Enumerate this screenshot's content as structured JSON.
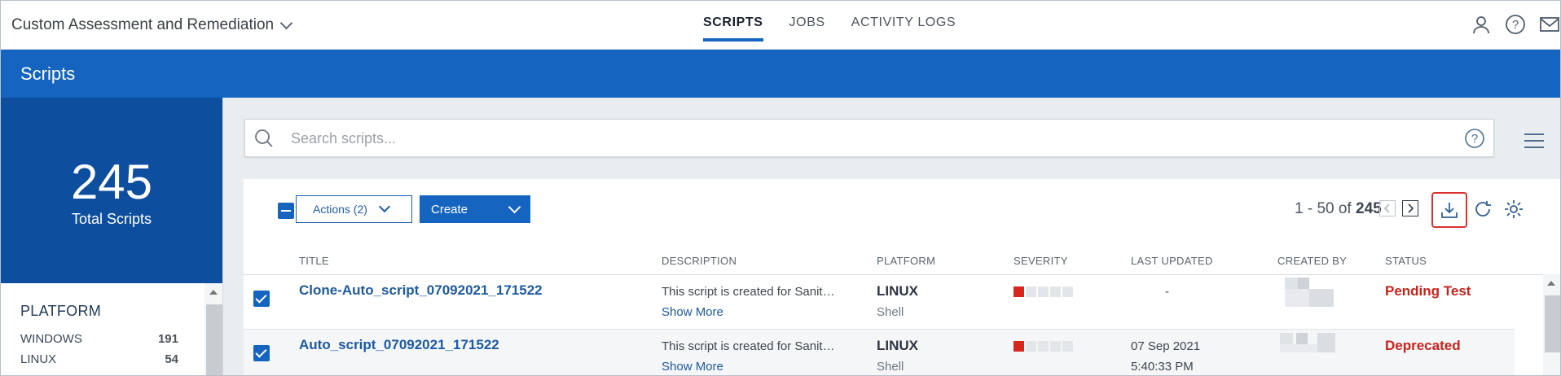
{
  "app": {
    "title": "Custom Assessment and Remediation"
  },
  "nav": {
    "tabs": [
      "SCRIPTS",
      "JOBS",
      "ACTIVITY LOGS"
    ]
  },
  "header": {
    "title": "Scripts"
  },
  "stats": {
    "total": "245",
    "label": "Total Scripts"
  },
  "facet": {
    "title": "PLATFORM",
    "items": [
      {
        "label": "WINDOWS",
        "count": "191"
      },
      {
        "label": "LINUX",
        "count": "54"
      }
    ]
  },
  "search": {
    "placeholder": "Search scripts..."
  },
  "toolbar": {
    "actions_label": "Actions (2)",
    "create_label": "Create"
  },
  "pager": {
    "range": "1 - 50 of",
    "total": "245"
  },
  "table": {
    "columns": [
      "TITLE",
      "DESCRIPTION",
      "PLATFORM",
      "SEVERITY",
      "LAST UPDATED",
      "CREATED BY",
      "STATUS"
    ],
    "rows": [
      {
        "title": "Clone-Auto_script_07092021_171522",
        "description": "This script is created for Sanit…",
        "show_more": "Show More",
        "platform": "LINUX",
        "platform_sub": "Shell",
        "severity": 1,
        "updated": "-",
        "updated_time": "",
        "status": "Pending Test"
      },
      {
        "title": "Auto_script_07092021_171522",
        "description": "This script is created for Sanit…",
        "show_more": "Show More",
        "platform": "LINUX",
        "platform_sub": "Shell",
        "severity": 1,
        "updated": "07 Sep 2021",
        "updated_time": "5:40:33 PM",
        "status": "Deprecated"
      }
    ]
  },
  "colors": {
    "brand": "#1565c0",
    "brand_dark": "#0d4f9e",
    "status_red": "#c8231c",
    "severity_red": "#d9261c"
  },
  "icons": [
    "chevron-down-icon",
    "user-icon",
    "help-icon",
    "mail-icon",
    "search-icon",
    "hamburger-menu-icon",
    "prev-page-icon",
    "next-page-icon",
    "download-icon",
    "refresh-icon",
    "settings-gear-icon"
  ]
}
